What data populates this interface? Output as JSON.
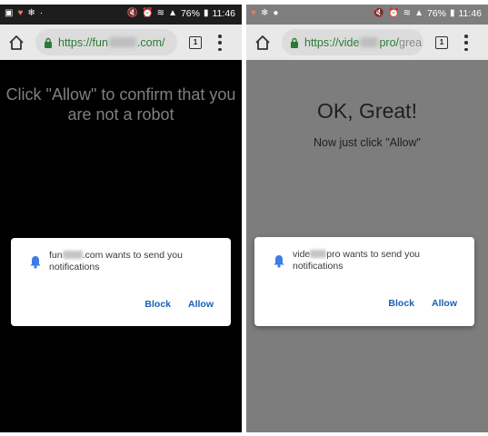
{
  "left_phone": {
    "status_bar": {
      "left_icons": [
        "gallery-icon",
        "heart-icon",
        "bug-icon",
        "dot-icon"
      ],
      "battery": "76%",
      "time": "11:46"
    },
    "toolbar": {
      "url": "https://fun",
      "url_suffix": ".com/",
      "tab_count": "1"
    },
    "page": {
      "headline": "Click \"Allow\" to confirm that you are not a robot"
    },
    "dialog": {
      "site_prefix": "fun",
      "message_after": ".com wants to send you notifications",
      "block_label": "Block",
      "allow_label": "Allow"
    }
  },
  "right_phone": {
    "status_bar": {
      "left_icons": [
        "heart-icon",
        "bug-icon",
        "circle-icon"
      ],
      "battery": "76%",
      "time": "11:46"
    },
    "toolbar": {
      "url": "https://vide",
      "url_suffix": "pro/",
      "url_tail": "grea",
      "tab_count": "1"
    },
    "page": {
      "headline": "OK, Great!",
      "subline": "Now just click \"Allow\""
    },
    "dialog": {
      "site_prefix": "vide",
      "message_after": "pro wants to send you notifications",
      "block_label": "Block",
      "allow_label": "Allow"
    }
  },
  "colors": {
    "left_status_bg": "#1d1d1d",
    "right_status_bg": "#7e7e7e",
    "toolbar_bg": "#e9e9e9",
    "url_green": "#2b7a35",
    "button_blue": "#1a5fb4",
    "bell_blue": "#3f7be6"
  }
}
